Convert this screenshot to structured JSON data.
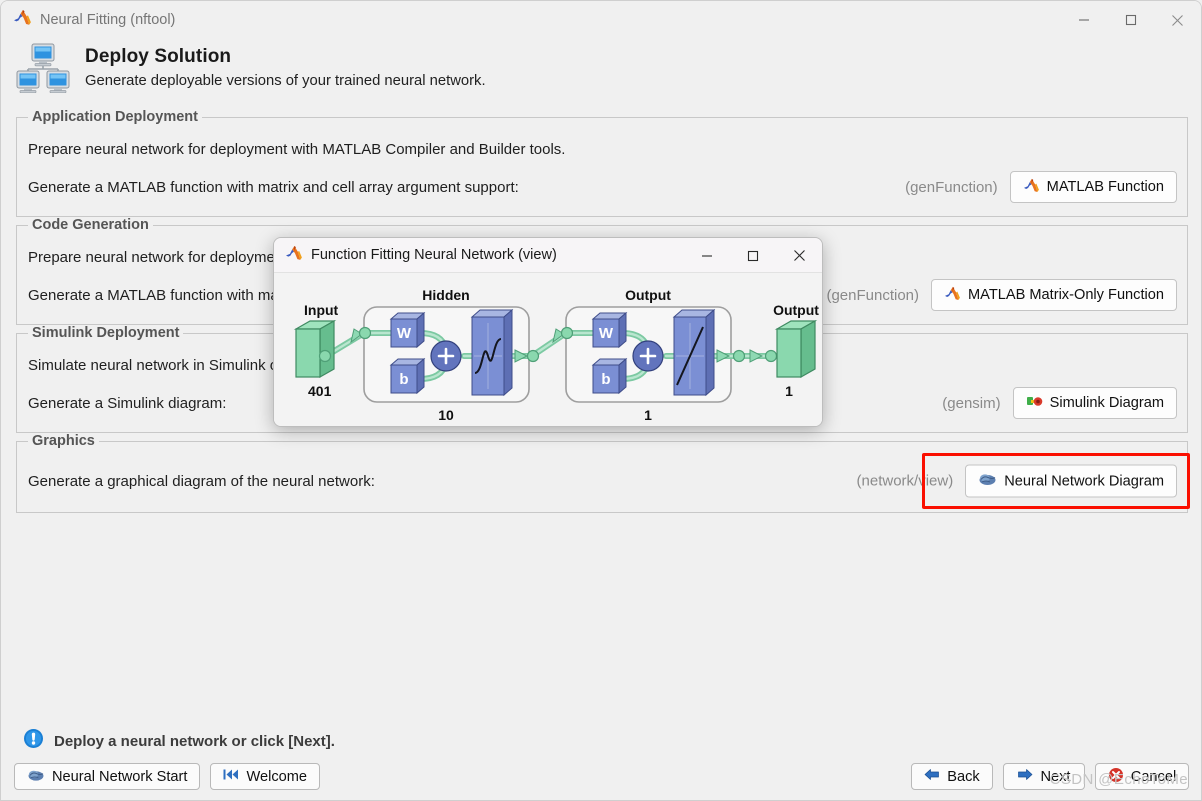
{
  "window": {
    "title": "Neural Fitting (nftool)",
    "app_icon": "matlab-logo-icon",
    "minimize": "—",
    "maximize": "□",
    "close": "✕"
  },
  "header": {
    "icon": "deploy-network-computers-icon",
    "title": "Deploy Solution",
    "subtitle": "Generate deployable versions of your trained neural network."
  },
  "groups": [
    {
      "id": "application-deployment",
      "title": "Application Deployment",
      "line1": "Prepare neural network for deployment with MATLAB Compiler and Builder tools.",
      "line2": "Generate a MATLAB function with matrix and cell array argument support:",
      "hint": "(genFunction)",
      "button": {
        "label": "MATLAB Function",
        "icon": "matlab-logo-icon"
      }
    },
    {
      "id": "code-generation",
      "title": "Code Generation",
      "line1": "Prepare neural network for deployment with MATLAB Coder tools.",
      "line2": "Generate a MATLAB function with matrix-only arguments for C/C++ code generation:",
      "hint": "(genFunction)",
      "hint_visible": "Function)",
      "button": {
        "label": "MATLAB Matrix-Only Function",
        "icon": "matlab-logo-icon"
      }
    },
    {
      "id": "simulink-deployment",
      "title": "Simulink Deployment",
      "line1": "Simulate neural network in Simulink or deploy with Simulink Coder tools.",
      "line2": "Generate a Simulink diagram:",
      "hint": "(gensim)",
      "button": {
        "label": "Simulink Diagram",
        "icon": "simulink-logo-icon"
      }
    },
    {
      "id": "graphics",
      "title": "Graphics",
      "line1": "",
      "line2": "Generate a graphical diagram of the neural network:",
      "hint": "(network/view)",
      "button": {
        "label": "Neural Network Diagram",
        "icon": "brain-icon"
      }
    }
  ],
  "highlight": {
    "color": "#fa0f00",
    "target": "neural-network-diagram-button"
  },
  "status": {
    "icon": "info-exclamation-icon",
    "text": "Deploy a neural network or click [Next]."
  },
  "footer": {
    "left_buttons": [
      {
        "label": "Neural Network Start",
        "icon": "brain-icon"
      },
      {
        "label": "Welcome",
        "icon": "rewind-icon"
      }
    ],
    "right_buttons": [
      {
        "label": "Back",
        "icon": "left-arrow-icon"
      },
      {
        "label": "Next",
        "icon": "right-arrow-icon"
      },
      {
        "label": "Cancel",
        "icon": "cancel-icon"
      }
    ]
  },
  "watermark": "CSDN @EchoToMe",
  "dialog": {
    "title": "Function Fitting Neural Network (view)",
    "icon": "matlab-logo-icon",
    "minimize": "—",
    "maximize": "□",
    "close": "✕",
    "diagram": {
      "input_label": "Input",
      "input_size": "401",
      "hidden_label": "Hidden",
      "hidden_size": "10",
      "output_layer_label": "Output",
      "output_layer_size": "1",
      "output_label": "Output",
      "output_size": "1",
      "weight_label": "W",
      "bias_label": "b",
      "sum_label": "+",
      "hidden_transfer": "tansig-sigmoid",
      "output_transfer": "purelin-linear",
      "colors": {
        "node_green": "#8ad8ae",
        "block_blue": "#7b8fd4",
        "circle_blue": "#6274bd",
        "link_green": "#9fdcbb"
      }
    }
  }
}
